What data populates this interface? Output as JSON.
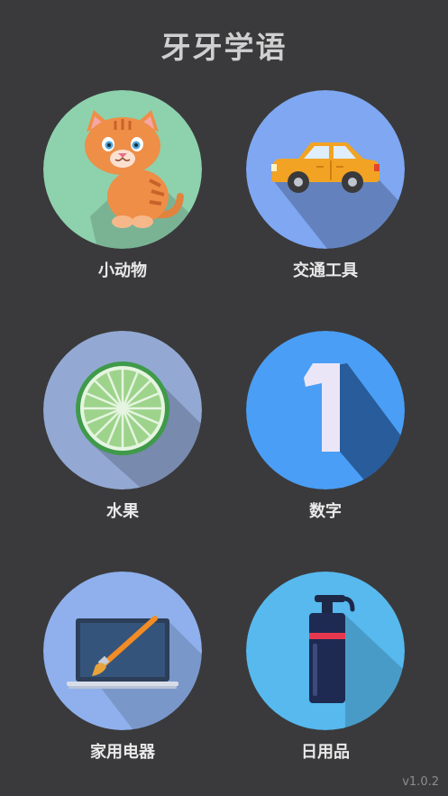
{
  "app": {
    "title": "牙牙学语",
    "version": "v1.0.2"
  },
  "categories": [
    {
      "label": "小动物",
      "icon": "cat-icon",
      "color": "#8ed1ad"
    },
    {
      "label": "交通工具",
      "icon": "car-icon",
      "color": "#7fa7f2"
    },
    {
      "label": "水果",
      "icon": "lime-slice-icon",
      "color": "#93a9d3"
    },
    {
      "label": "数字",
      "icon": "number-one-icon",
      "color": "#4a9ef5"
    },
    {
      "label": "家用电器",
      "icon": "monitor-paintbrush-icon",
      "color": "#8fb0ec"
    },
    {
      "label": "日用品",
      "icon": "pump-bottle-icon",
      "color": "#57b9ee"
    }
  ]
}
